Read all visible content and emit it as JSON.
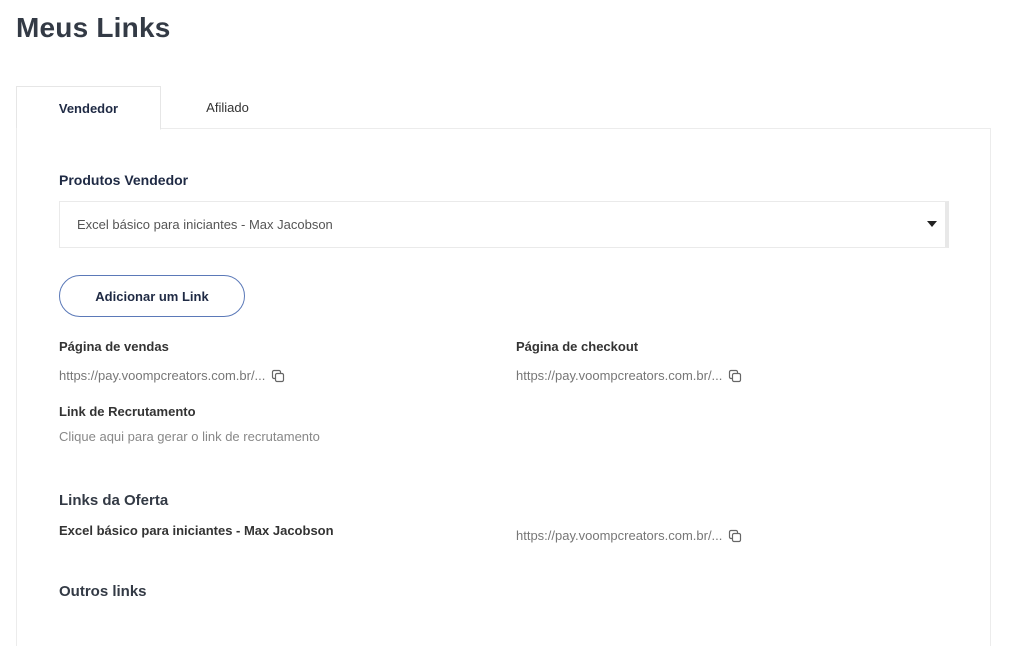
{
  "page": {
    "title": "Meus Links"
  },
  "tabs": [
    {
      "label": "Vendedor",
      "active": true
    },
    {
      "label": "Afiliado",
      "active": false
    }
  ],
  "products": {
    "label": "Produtos Vendedor",
    "selected": "Excel básico para iniciantes - Max Jacobson"
  },
  "add_link_button": "Adicionar um Link",
  "sales_page": {
    "label": "Página de vendas",
    "url": "https://pay.voompcreators.com.br/..."
  },
  "checkout_page": {
    "label": "Página de checkout",
    "url": "https://pay.voompcreators.com.br/..."
  },
  "recruitment": {
    "label": "Link de Recrutamento",
    "hint": "Clique aqui para gerar o link de recrutamento"
  },
  "offer_links": {
    "title": "Links da Oferta",
    "items": [
      {
        "name": "Excel básico para iniciantes - Max Jacobson",
        "url": "https://pay.voompcreators.com.br/..."
      }
    ]
  },
  "other_links": {
    "title": "Outros links"
  },
  "icons": {
    "copy": "copy-icon",
    "dropdown": "caret-down-icon"
  }
}
